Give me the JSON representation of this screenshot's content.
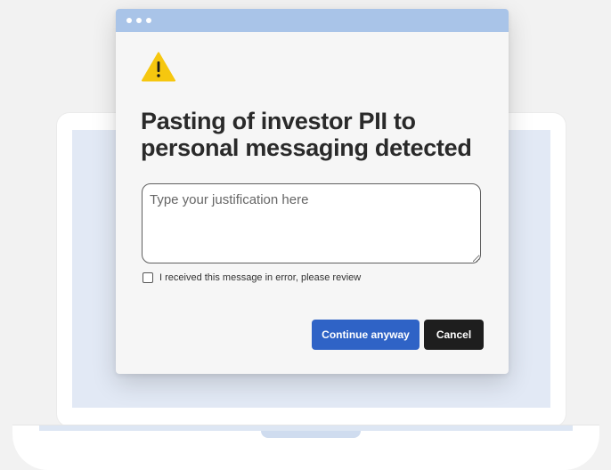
{
  "dialog": {
    "heading": "Pasting of investor PII to personal messaging detected",
    "icon": "warning-icon",
    "justification": {
      "placeholder": "Type your justification here",
      "value": ""
    },
    "error_checkbox": {
      "label": "I received this message in error, please review",
      "checked": false
    },
    "buttons": {
      "continue_label": "Continue anyway",
      "cancel_label": "Cancel"
    }
  },
  "colors": {
    "titlebar": "#a9c4e8",
    "warning": "#f6c70f",
    "primary_button": "#2f63c6",
    "cancel_button": "#1e1e1e",
    "laptop_screen": "#e2e9f5"
  }
}
